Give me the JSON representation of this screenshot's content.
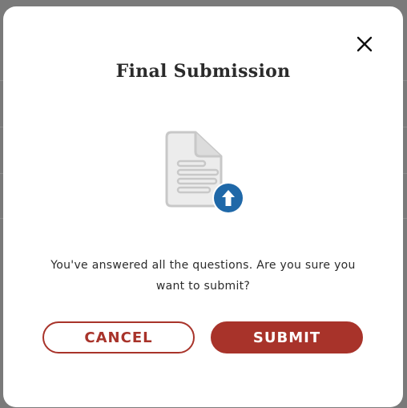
{
  "dialog": {
    "title": "Final Submission",
    "message_line1": "You've answered all the questions. Are you sure you",
    "message_line2": "want to submit?",
    "cancel_label": "CANCEL",
    "submit_label": "SUBMIT",
    "close_icon": "close-icon",
    "illustration_icon": "document-upload-icon"
  },
  "colors": {
    "accent": "#a8332a",
    "upload_badge": "#1f68a8",
    "document_gray": "#c8c8c8",
    "backdrop": "#7a7a7a"
  }
}
